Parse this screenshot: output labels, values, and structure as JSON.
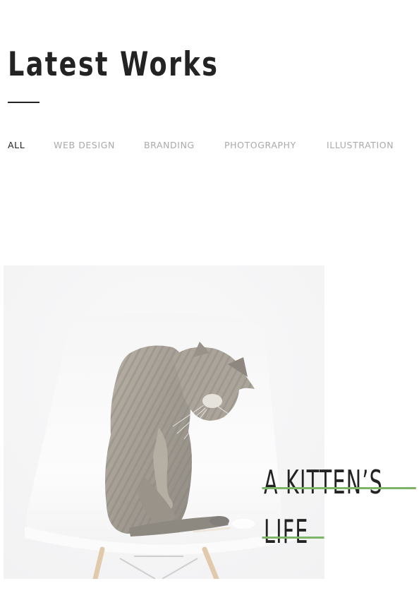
{
  "section": {
    "title": "Latest Works"
  },
  "filters": [
    {
      "label": "ALL",
      "active": true
    },
    {
      "label": "WEB DESIGN",
      "active": false
    },
    {
      "label": "BRANDING",
      "active": false
    },
    {
      "label": "PHOTOGRAPHY",
      "active": false
    },
    {
      "label": "ILLUSTRATION",
      "active": false
    }
  ],
  "portfolio": {
    "item": {
      "title_line_1": "A KITTEN’S",
      "title_line_2": "LIFE",
      "image_subject": "tabby cat playing on a white chair",
      "strike_color": "#7cb46a"
    }
  },
  "colors": {
    "text_dark": "#232323",
    "text_muted": "#aaaaaa",
    "image_background": "#f3f3f4",
    "accent": "#7cb46a"
  }
}
